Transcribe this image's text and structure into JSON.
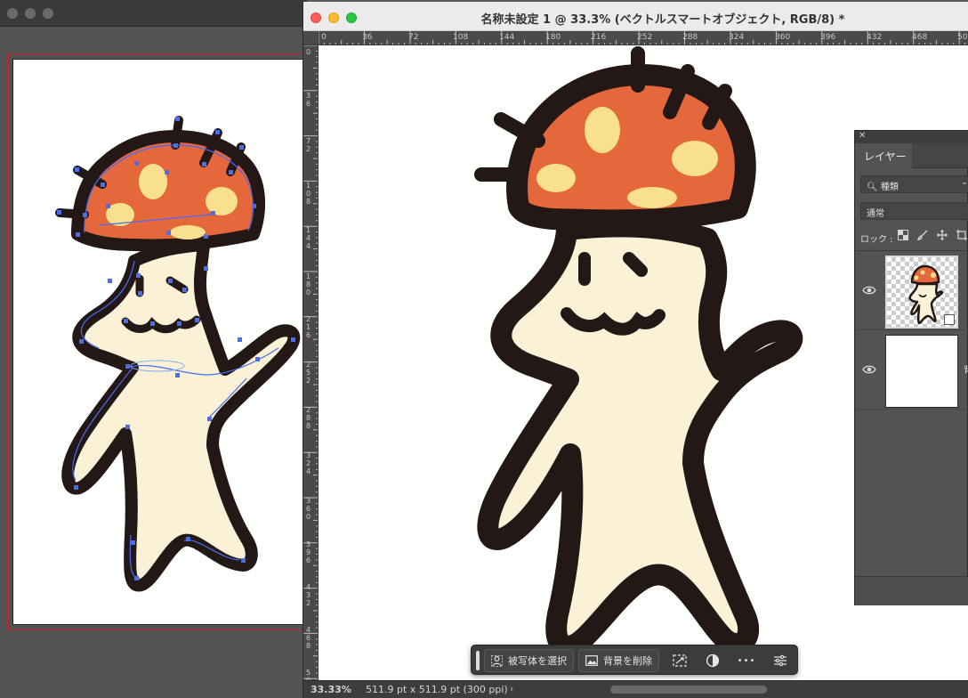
{
  "back_window": {
    "title": ""
  },
  "ps_window": {
    "title": "名称未設定 1 @ 33.3% (ベクトルスマートオブジェクト, RGB/8) *",
    "ruler_top": [
      "0",
      "36",
      "72",
      "108",
      "144",
      "180",
      "216",
      "252",
      "288",
      "324",
      "360",
      "396",
      "432",
      "468",
      "50"
    ],
    "ruler_left": [
      "0",
      "36",
      "72",
      "108",
      "144",
      "180",
      "216",
      "252",
      "288",
      "324",
      "360",
      "396",
      "432",
      "468",
      "50"
    ],
    "status": {
      "zoom": "33.33%",
      "doc_size": "511.9 pt x 511.9 pt (300 ppi)",
      "arrow": "›"
    }
  },
  "taskbar": {
    "select_subject": "被写体を選択",
    "remove_background": "背景を削除",
    "icons": [
      "transform-icon",
      "adjust-circle-icon",
      "more-icon",
      "sliders-icon"
    ],
    "more_glyph": "•••"
  },
  "layers_panel": {
    "tab": "レイヤー",
    "filter_label": "種類",
    "blend_mode": "通常",
    "lock_label": "ロック :",
    "layers": [
      {
        "name": "",
        "type": "smart-object",
        "visible": true
      },
      {
        "name": "背",
        "type": "background",
        "visible": true
      }
    ]
  },
  "colors": {
    "cap": "#e5673c",
    "spot": "#f8e08e",
    "body": "#fbf1d7",
    "outline": "#231815",
    "path": "#4a6cf2"
  }
}
